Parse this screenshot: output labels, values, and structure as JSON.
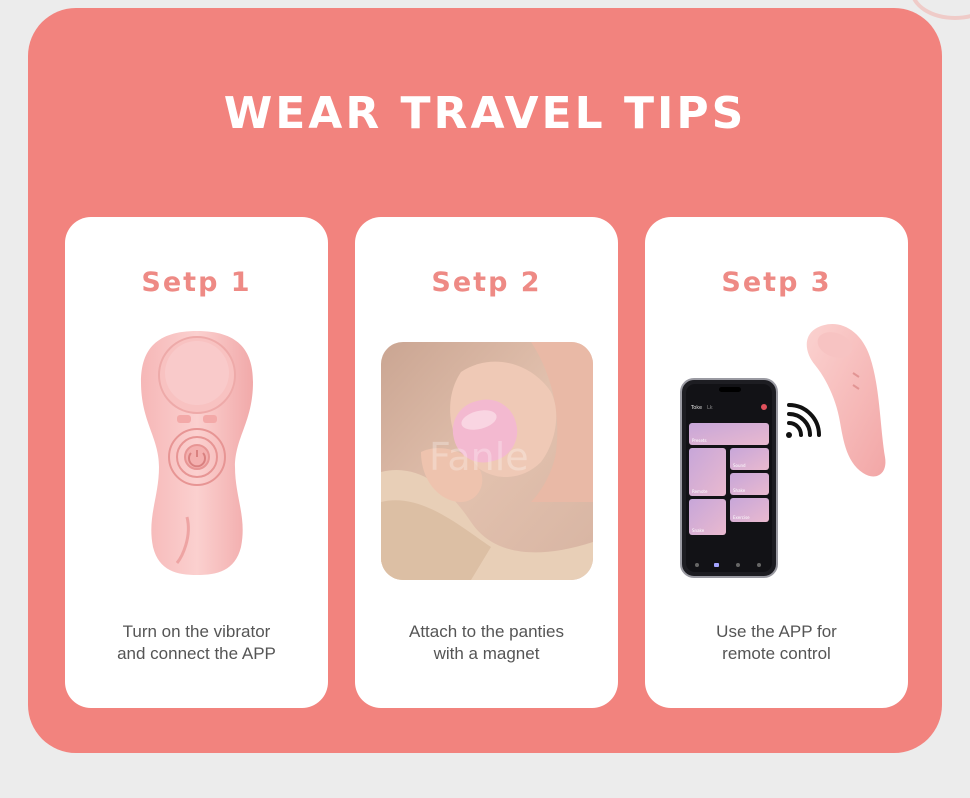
{
  "page": {
    "title": "WEAR TRAVEL TIPS",
    "colors": {
      "panel": "#f2837e",
      "step_title": "#ee8a85",
      "card": "#ffffff"
    }
  },
  "steps": [
    {
      "title": "Setp 1",
      "caption_line1": "Turn on the vibrator",
      "caption_line2": "and connect the APP",
      "illustration": "pink-vibrator-image"
    },
    {
      "title": "Setp 2",
      "caption_line1": "Attach to the panties",
      "caption_line2": "with a magnet",
      "illustration": "hand-attaching-device-photo"
    },
    {
      "title": "Setp 3",
      "caption_line1": "Use the APP for",
      "caption_line2": "remote control",
      "illustration": "phone-app-remote-image"
    }
  ],
  "photo_watermark": "Fanle",
  "phone_app": {
    "tabs": [
      "Toke",
      "Lk"
    ],
    "tiles": [
      "Presets",
      "Remote",
      "Sound",
      "Shake",
      "Snake",
      "Exercise"
    ]
  }
}
